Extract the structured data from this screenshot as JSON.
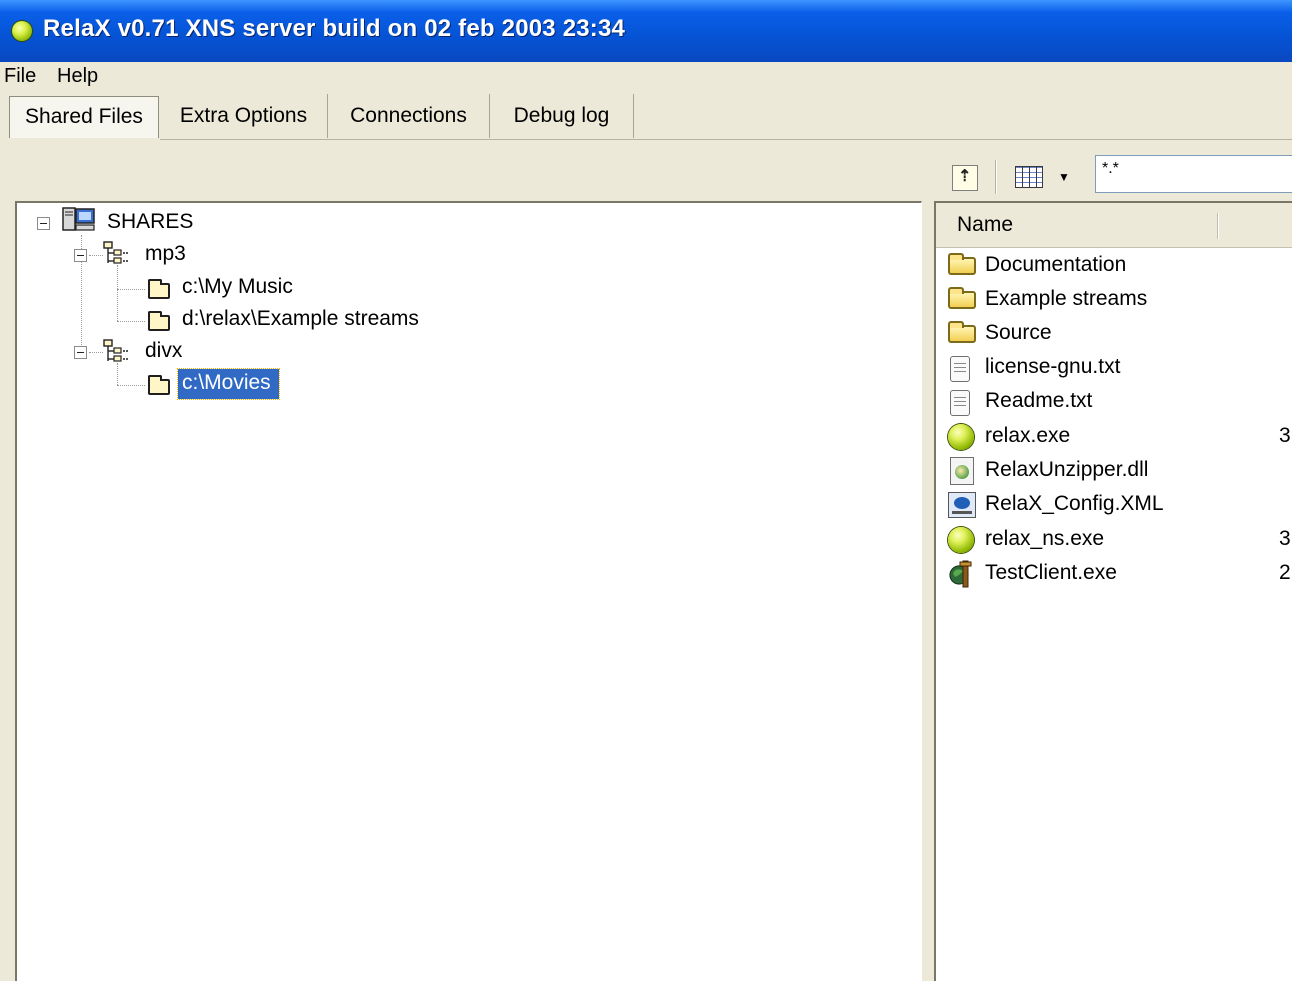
{
  "window": {
    "title": "RelaX v0.71 XNS server build on 02 feb 2003 23:34"
  },
  "menu": {
    "file": "File",
    "help": "Help"
  },
  "tabs": [
    "Shared Files",
    "Extra Options",
    "Connections",
    "Debug log"
  ],
  "toolbar": {
    "filter_value": "*.*"
  },
  "tree": {
    "root": "SHARES",
    "groups": [
      {
        "label": "mp3",
        "folders": [
          "c:\\My Music",
          "d:\\relax\\Example streams"
        ]
      },
      {
        "label": "divx",
        "folders": [
          "c:\\Movies"
        ]
      }
    ],
    "selected": "c:\\Movies"
  },
  "list": {
    "column_name": "Name",
    "files": [
      {
        "name": "Documentation",
        "icon": "folder-icon",
        "size": ""
      },
      {
        "name": "Example streams",
        "icon": "folder-icon",
        "size": ""
      },
      {
        "name": "Source",
        "icon": "folder-icon",
        "size": ""
      },
      {
        "name": "license-gnu.txt",
        "icon": "text-file-icon",
        "size": ""
      },
      {
        "name": "Readme.txt",
        "icon": "text-file-icon",
        "size": ""
      },
      {
        "name": "relax.exe",
        "icon": "relax-exe-icon",
        "size": "3"
      },
      {
        "name": "RelaxUnzipper.dll",
        "icon": "dll-file-icon",
        "size": ""
      },
      {
        "name": "RelaX_Config.XML",
        "icon": "xml-file-icon",
        "size": ""
      },
      {
        "name": "relax_ns.exe",
        "icon": "relax-exe-icon",
        "size": "3"
      },
      {
        "name": "TestClient.exe",
        "icon": "test-client-icon",
        "size": "2"
      }
    ]
  }
}
